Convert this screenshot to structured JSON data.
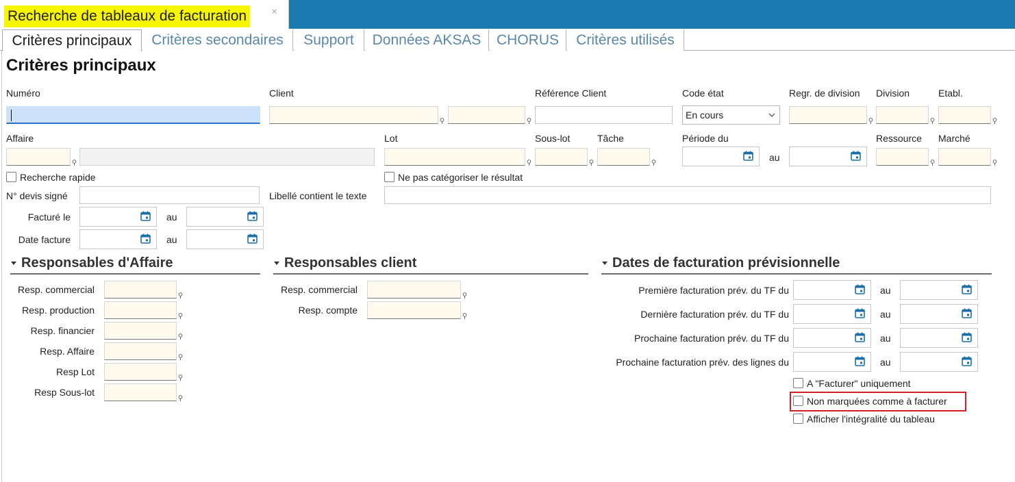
{
  "window": {
    "doc_title": "Recherche de tableaux de facturation",
    "close_glyph": "×"
  },
  "tabs": [
    {
      "label": "Critères principaux",
      "active": true
    },
    {
      "label": "Critères secondaires",
      "active": false
    },
    {
      "label": "Support",
      "active": false
    },
    {
      "label": "Données AKSAS",
      "active": false
    },
    {
      "label": "CHORUS",
      "active": false
    },
    {
      "label": "Critères utilisés",
      "active": false
    }
  ],
  "page_title": "Critères principaux",
  "labels": {
    "numero": "Numéro",
    "client": "Client",
    "ref_client": "Référence Client",
    "code_etat": "Code état",
    "regr_division": "Regr. de division",
    "division": "Division",
    "etabl": "Etabl.",
    "affaire": "Affaire",
    "lot": "Lot",
    "sous_lot": "Sous-lot",
    "tache": "Tâche",
    "periode_du": "Période du",
    "au": "au",
    "ressource": "Ressource",
    "marche": "Marché",
    "devis": "N° devis signé",
    "libelle": "Libellé contient le texte",
    "facture_le": "Facturé le",
    "date_facture": "Date facture"
  },
  "code_etat_value": "En cours",
  "checkboxes": {
    "recherche_rapide": {
      "label": "Recherche rapide",
      "checked": false
    },
    "ne_pas_categoriser": {
      "label": "Ne pas catégoriser le résultat",
      "checked": false
    },
    "a_facturer": {
      "label": "A \"Facturer\" uniquement",
      "checked": false
    },
    "non_marquees": {
      "label": "Non marquées comme à facturer",
      "checked": false
    },
    "afficher_integralite": {
      "label": "Afficher l'intégralité du tableau",
      "checked": false
    }
  },
  "sections": {
    "resp_affaire": {
      "title": "Responsables d'Affaire",
      "fields": [
        "Resp. commercial",
        "Resp. production",
        "Resp. financier",
        "Resp. Affaire",
        "Resp Lot",
        "Resp Sous-lot"
      ]
    },
    "resp_client": {
      "title": "Responsables client",
      "fields": [
        "Resp. commercial",
        "Resp. compte"
      ]
    },
    "dates_prev": {
      "title": "Dates de facturation prévisionnelle",
      "fields": [
        "Première facturation prév. du TF du",
        "Dernière facturation prév. du TF du",
        "Prochaine facturation prév. du TF du",
        "Prochaine facturation prév. des lignes du"
      ]
    }
  },
  "colors": {
    "title_bar": "#1b7bb0",
    "title_highlight": "#f6f600",
    "field_bg": "#fffaee",
    "red_box": "#d12020",
    "icon_blue": "#1b6fa8"
  }
}
